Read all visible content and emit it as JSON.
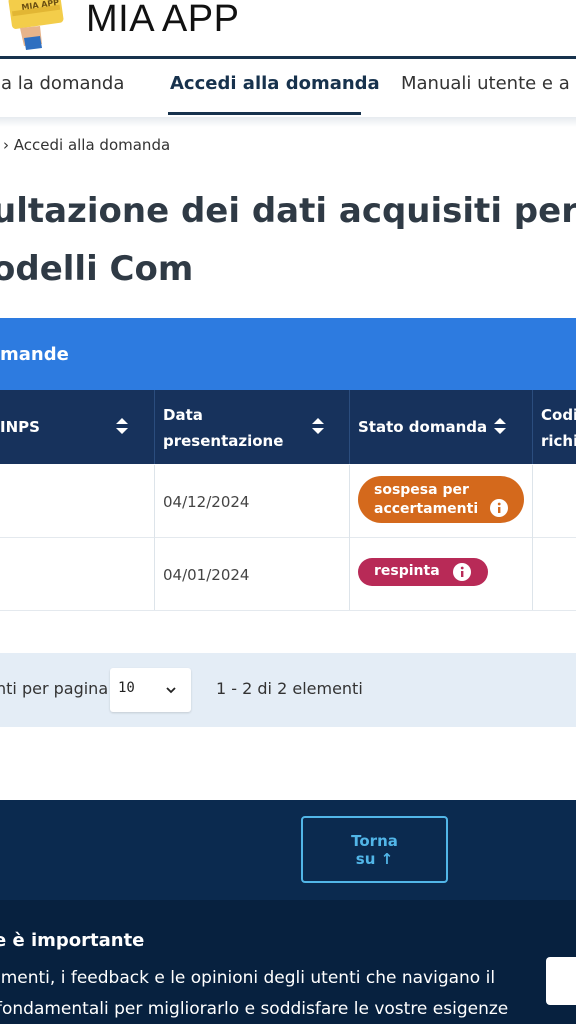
{
  "app": {
    "title": "MIA APP",
    "logo_text": "MIA APP"
  },
  "nav": {
    "tabs": [
      {
        "label": "la la domanda",
        "active": false
      },
      {
        "label": "Accedi alla domanda",
        "active": true
      },
      {
        "label": "Manuali utente e a",
        "active": false
      }
    ]
  },
  "breadcrumb": "› Accedi alla domanda",
  "page": {
    "title_line1": "ultazione dei dati acquisiti per la do",
    "title_line2": "odelli Com"
  },
  "table": {
    "panel_title": "mande",
    "headers": [
      "INPS",
      "Data\npresentazione",
      "Stato domanda",
      "Codic\nrichie"
    ],
    "header_line1": {
      "inps": "INPS",
      "data": "Data",
      "stato": "Stato domanda",
      "codice": "Codic"
    },
    "header_line2": {
      "data": "presentazione",
      "codice": "richie"
    },
    "rows": [
      {
        "date": "04/12/2024",
        "status_line1": "sospesa per",
        "status_line2": "accertamenti",
        "status_color": "#d4691c"
      },
      {
        "date": "04/01/2024",
        "status_line1": "respinta",
        "status_line2": "",
        "status_color": "#b82a57"
      }
    ]
  },
  "pagination": {
    "per_page_label": "nti per pagina:",
    "per_page_value": "10",
    "range_text": "1 - 2 di 2 elementi"
  },
  "footer": {
    "back_to_top_line1": "Torna",
    "back_to_top_line2": "su ↑"
  },
  "feedback": {
    "title": "e è importante",
    "line1": "imenti, i feedback e le opinioni degli utenti che navigano il",
    "line2": "fondamentali per migliorarlo e soddisfare le vostre esigenze"
  },
  "colors": {
    "primary_dark": "#17325c",
    "accent_blue": "#2d7be0",
    "footer_bg": "#0b2a4f",
    "link_cyan": "#52b6e8"
  }
}
